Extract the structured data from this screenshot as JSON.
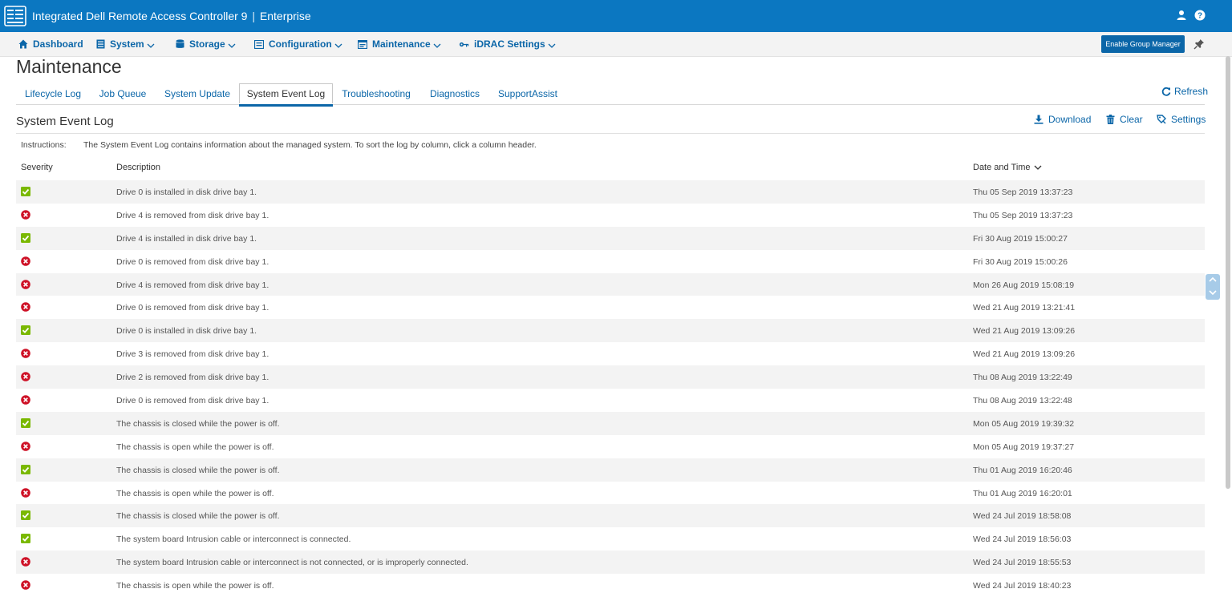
{
  "header": {
    "product": "Integrated Dell Remote Access Controller 9",
    "separator": "|",
    "edition": "Enterprise",
    "bar_color": "#0b77c1",
    "icons": [
      "idrac-logo-icon",
      "user-icon",
      "help-icon"
    ]
  },
  "nav": {
    "items": [
      {
        "label": "Dashboard",
        "icon": "home-icon"
      },
      {
        "label": "System",
        "icon": "server-icon"
      },
      {
        "label": "Storage",
        "icon": "database-icon"
      },
      {
        "label": "Configuration",
        "icon": "config-icon"
      },
      {
        "label": "Maintenance",
        "icon": "maintenance-icon"
      },
      {
        "label": "iDRAC Settings",
        "icon": "keys-icon"
      }
    ],
    "group_manager_label": "Enable Group Manager"
  },
  "page": {
    "title": "Maintenance",
    "tabs": [
      "Lifecycle Log",
      "Job Queue",
      "System Update",
      "System Event Log",
      "Troubleshooting",
      "Diagnostics",
      "SupportAssist"
    ],
    "active_tab": "System Event Log",
    "refresh_label": "Refresh"
  },
  "sel": {
    "title": "System Event Log",
    "download_label": "Download",
    "clear_label": "Clear",
    "settings_label": "Settings",
    "instructions_label": "Instructions:",
    "instructions_text": "The System Event Log contains information about the managed system. To sort the log by column, click a column header.",
    "columns": {
      "severity": "Severity",
      "description": "Description",
      "datetime": "Date and Time"
    },
    "status_colors": {
      "ok": "#7ab800",
      "critical": "#ce1126"
    },
    "rows": [
      {
        "severity": "ok",
        "description": "Drive 0 is installed in disk drive bay 1.",
        "datetime": "Thu 05 Sep 2019 13:37:23"
      },
      {
        "severity": "critical",
        "description": "Drive 4 is removed from disk drive bay 1.",
        "datetime": "Thu 05 Sep 2019 13:37:23"
      },
      {
        "severity": "ok",
        "description": "Drive 4 is installed in disk drive bay 1.",
        "datetime": "Fri 30 Aug 2019 15:00:27"
      },
      {
        "severity": "critical",
        "description": "Drive 0 is removed from disk drive bay 1.",
        "datetime": "Fri 30 Aug 2019 15:00:26"
      },
      {
        "severity": "critical",
        "description": "Drive 4 is removed from disk drive bay 1.",
        "datetime": "Mon 26 Aug 2019 15:08:19"
      },
      {
        "severity": "critical",
        "description": "Drive 0 is removed from disk drive bay 1.",
        "datetime": "Wed 21 Aug 2019 13:21:41"
      },
      {
        "severity": "ok",
        "description": "Drive 0 is installed in disk drive bay 1.",
        "datetime": "Wed 21 Aug 2019 13:09:26"
      },
      {
        "severity": "critical",
        "description": "Drive 3 is removed from disk drive bay 1.",
        "datetime": "Wed 21 Aug 2019 13:09:26"
      },
      {
        "severity": "critical",
        "description": "Drive 2 is removed from disk drive bay 1.",
        "datetime": "Thu 08 Aug 2019 13:22:49"
      },
      {
        "severity": "critical",
        "description": "Drive 0 is removed from disk drive bay 1.",
        "datetime": "Thu 08 Aug 2019 13:22:48"
      },
      {
        "severity": "ok",
        "description": "The chassis is closed while the power is off.",
        "datetime": "Mon 05 Aug 2019 19:39:32"
      },
      {
        "severity": "critical",
        "description": "The chassis is open while the power is off.",
        "datetime": "Mon 05 Aug 2019 19:37:27"
      },
      {
        "severity": "ok",
        "description": "The chassis is closed while the power is off.",
        "datetime": "Thu 01 Aug 2019 16:20:46"
      },
      {
        "severity": "critical",
        "description": "The chassis is open while the power is off.",
        "datetime": "Thu 01 Aug 2019 16:20:01"
      },
      {
        "severity": "ok",
        "description": "The chassis is closed while the power is off.",
        "datetime": "Wed 24 Jul 2019 18:58:08"
      },
      {
        "severity": "ok",
        "description": "The system board Intrusion cable or interconnect is connected.",
        "datetime": "Wed 24 Jul 2019 18:56:03"
      },
      {
        "severity": "critical",
        "description": "The system board Intrusion cable or interconnect is not connected, or is improperly connected.",
        "datetime": "Wed 24 Jul 2019 18:55:53"
      },
      {
        "severity": "critical",
        "description": "The chassis is open while the power is off.",
        "datetime": "Wed 24 Jul 2019 18:40:23"
      }
    ]
  }
}
